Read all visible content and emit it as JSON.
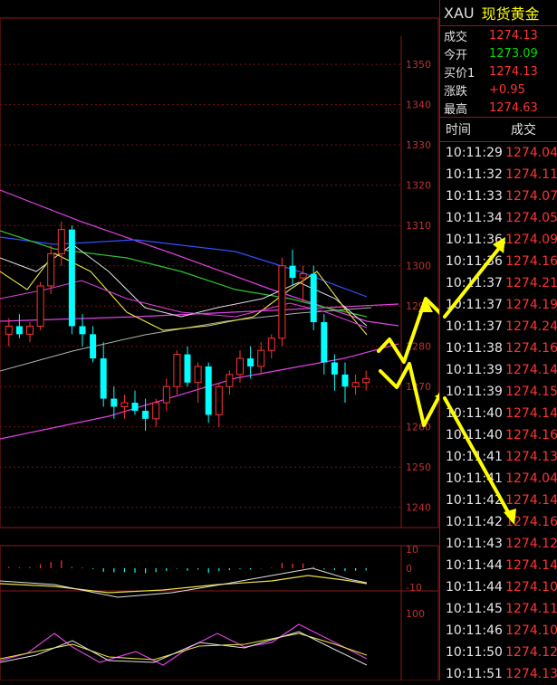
{
  "quote": {
    "symbol": "XAU",
    "name": "现货黄金",
    "rows": [
      {
        "label": "成交",
        "value": "1274.13",
        "color": "#ff3333"
      },
      {
        "label": "今开",
        "value": "1273.09",
        "color": "#00dd00"
      },
      {
        "label": "买价1",
        "value": "1274.13",
        "color": "#ff3333"
      },
      {
        "label": "涨跌",
        "value": "+0.95",
        "color": "#ff3333"
      },
      {
        "label": "最高",
        "value": "1274.63",
        "color": "#ff3333"
      }
    ]
  },
  "ticks": {
    "header_time": "时间",
    "header_price": "成交",
    "rows": [
      {
        "time": "10:11:29",
        "price": "1274.04"
      },
      {
        "time": "10:11:32",
        "price": "1274.11"
      },
      {
        "time": "10:11:33",
        "price": "1274.07"
      },
      {
        "time": "10:11:34",
        "price": "1274.05"
      },
      {
        "time": "10:11:36",
        "price": "1274.09"
      },
      {
        "time": "10:11:36",
        "price": "1274.16"
      },
      {
        "time": "10:11:37",
        "price": "1274.21"
      },
      {
        "time": "10:11:37",
        "price": "1274.19"
      },
      {
        "time": "10:11:37",
        "price": "1274.24"
      },
      {
        "time": "10:11:38",
        "price": "1274.16"
      },
      {
        "time": "10:11:39",
        "price": "1274.14"
      },
      {
        "time": "10:11:39",
        "price": "1274.15"
      },
      {
        "time": "10:11:40",
        "price": "1274.14"
      },
      {
        "time": "10:11:40",
        "price": "1274.16"
      },
      {
        "time": "10:11:41",
        "price": "1274.13"
      },
      {
        "time": "10:11:41",
        "price": "1274.04"
      },
      {
        "time": "10:11:42",
        "price": "1274.14"
      },
      {
        "time": "10:11:42",
        "price": "1274.16"
      },
      {
        "time": "10:11:43",
        "price": "1274.12"
      },
      {
        "time": "10:11:44",
        "price": "1274.14"
      },
      {
        "time": "10:11:44",
        "price": "1274.10"
      },
      {
        "time": "10:11:45",
        "price": "1274.11"
      },
      {
        "time": "10:11:46",
        "price": "1274.10"
      },
      {
        "time": "10:11:50",
        "price": "1274.12"
      },
      {
        "time": "10:11:51",
        "price": "1274.13"
      }
    ]
  },
  "chart_data": [
    {
      "type": "candlestick",
      "y_ticks": [
        "1350",
        "1340",
        "1330",
        "1320",
        "1310",
        "1300",
        "1290",
        "1280",
        "1270",
        "1260",
        "1250",
        "1240"
      ],
      "ylim": [
        1235,
        1357
      ],
      "grid": true,
      "candles": [
        {
          "o": 1283,
          "h": 1287,
          "l": 1280,
          "c": 1285
        },
        {
          "o": 1285,
          "h": 1288,
          "l": 1282,
          "c": 1283
        },
        {
          "o": 1283,
          "h": 1286,
          "l": 1281,
          "c": 1285
        },
        {
          "o": 1285,
          "h": 1296,
          "l": 1284,
          "c": 1295
        },
        {
          "o": 1295,
          "h": 1305,
          "l": 1293,
          "c": 1303
        },
        {
          "o": 1303,
          "h": 1311,
          "l": 1300,
          "c": 1309
        },
        {
          "o": 1309,
          "h": 1310,
          "l": 1283,
          "c": 1285
        },
        {
          "o": 1285,
          "h": 1288,
          "l": 1280,
          "c": 1283
        },
        {
          "o": 1283,
          "h": 1285,
          "l": 1276,
          "c": 1277
        },
        {
          "o": 1277,
          "h": 1281,
          "l": 1265,
          "c": 1267
        },
        {
          "o": 1267,
          "h": 1270,
          "l": 1262,
          "c": 1265
        },
        {
          "o": 1265,
          "h": 1268,
          "l": 1262,
          "c": 1266
        },
        {
          "o": 1266,
          "h": 1269,
          "l": 1263,
          "c": 1264
        },
        {
          "o": 1264,
          "h": 1267,
          "l": 1259,
          "c": 1262
        },
        {
          "o": 1262,
          "h": 1267,
          "l": 1260,
          "c": 1266
        },
        {
          "o": 1266,
          "h": 1272,
          "l": 1264,
          "c": 1270
        },
        {
          "o": 1270,
          "h": 1279,
          "l": 1268,
          "c": 1278
        },
        {
          "o": 1278,
          "h": 1280,
          "l": 1270,
          "c": 1271
        },
        {
          "o": 1271,
          "h": 1276,
          "l": 1266,
          "c": 1275
        },
        {
          "o": 1275,
          "h": 1276,
          "l": 1261,
          "c": 1263
        },
        {
          "o": 1263,
          "h": 1271,
          "l": 1260,
          "c": 1270
        },
        {
          "o": 1270,
          "h": 1274,
          "l": 1268,
          "c": 1273
        },
        {
          "o": 1273,
          "h": 1279,
          "l": 1271,
          "c": 1277
        },
        {
          "o": 1277,
          "h": 1280,
          "l": 1272,
          "c": 1275
        },
        {
          "o": 1275,
          "h": 1281,
          "l": 1273,
          "c": 1279
        },
        {
          "o": 1279,
          "h": 1283,
          "l": 1277,
          "c": 1282
        },
        {
          "o": 1282,
          "h": 1302,
          "l": 1280,
          "c": 1300
        },
        {
          "o": 1300,
          "h": 1304,
          "l": 1295,
          "c": 1297
        },
        {
          "o": 1297,
          "h": 1300,
          "l": 1291,
          "c": 1298
        },
        {
          "o": 1298,
          "h": 1300,
          "l": 1284,
          "c": 1286
        },
        {
          "o": 1286,
          "h": 1288,
          "l": 1273,
          "c": 1276
        },
        {
          "o": 1276,
          "h": 1278,
          "l": 1269,
          "c": 1273
        },
        {
          "o": 1273,
          "h": 1276,
          "l": 1266,
          "c": 1270
        },
        {
          "o": 1270,
          "h": 1273,
          "l": 1268,
          "c": 1271
        },
        {
          "o": 1271,
          "h": 1274,
          "l": 1269,
          "c": 1272
        }
      ]
    },
    {
      "type": "bar",
      "y_ticks": [
        "10",
        "0",
        "-10"
      ],
      "ylim": [
        -12,
        12
      ]
    },
    {
      "type": "line",
      "y_ticks": [
        "100"
      ]
    }
  ],
  "colors": {
    "up": "#ff3333",
    "down": "#00ffff",
    "grid": "#7a1010",
    "annotation_arrow": "#ffff00"
  }
}
